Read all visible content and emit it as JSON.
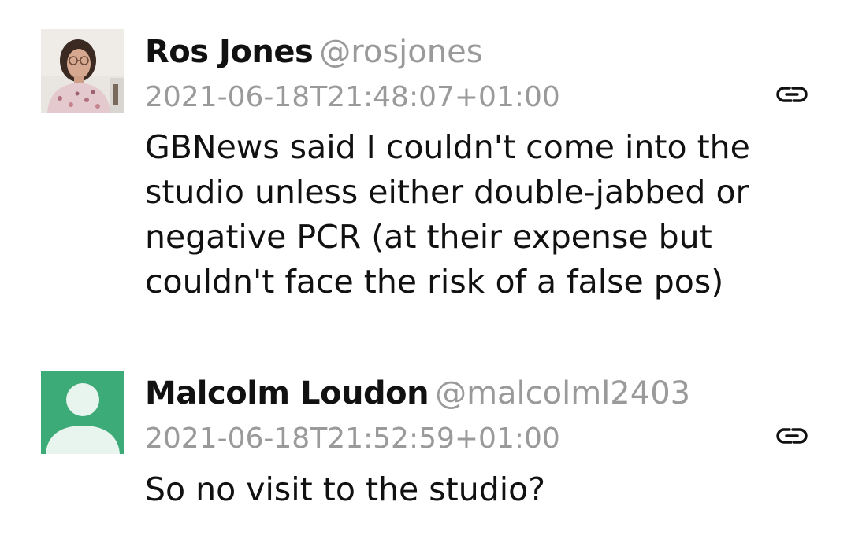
{
  "tweets": [
    {
      "display_name": "Ros Jones",
      "handle": "@rosjones",
      "timestamp": "2021-06-18T21:48:07+01:00",
      "text": "GBNews said I couldn't come into the\nstudio unless either double-jabbed or\nnegative PCR (at their expense but\ncouldn't face the risk of a false pos)",
      "avatar": "photo",
      "link_icon": "link-icon"
    },
    {
      "display_name": "Malcolm Loudon",
      "handle": "@malcolml2403",
      "timestamp": "2021-06-18T21:52:59+01:00",
      "text": "So no visit to the studio?",
      "avatar": "default-avatar",
      "avatar_color": "#3dab77",
      "link_icon": "link-icon"
    }
  ],
  "colors": {
    "name": "#111111",
    "handle": "#9a9a9a",
    "timestamp": "#9a9a9a",
    "text": "#111111",
    "default_avatar_bg": "#3dab77",
    "default_avatar_fg": "#e8f4ee"
  }
}
